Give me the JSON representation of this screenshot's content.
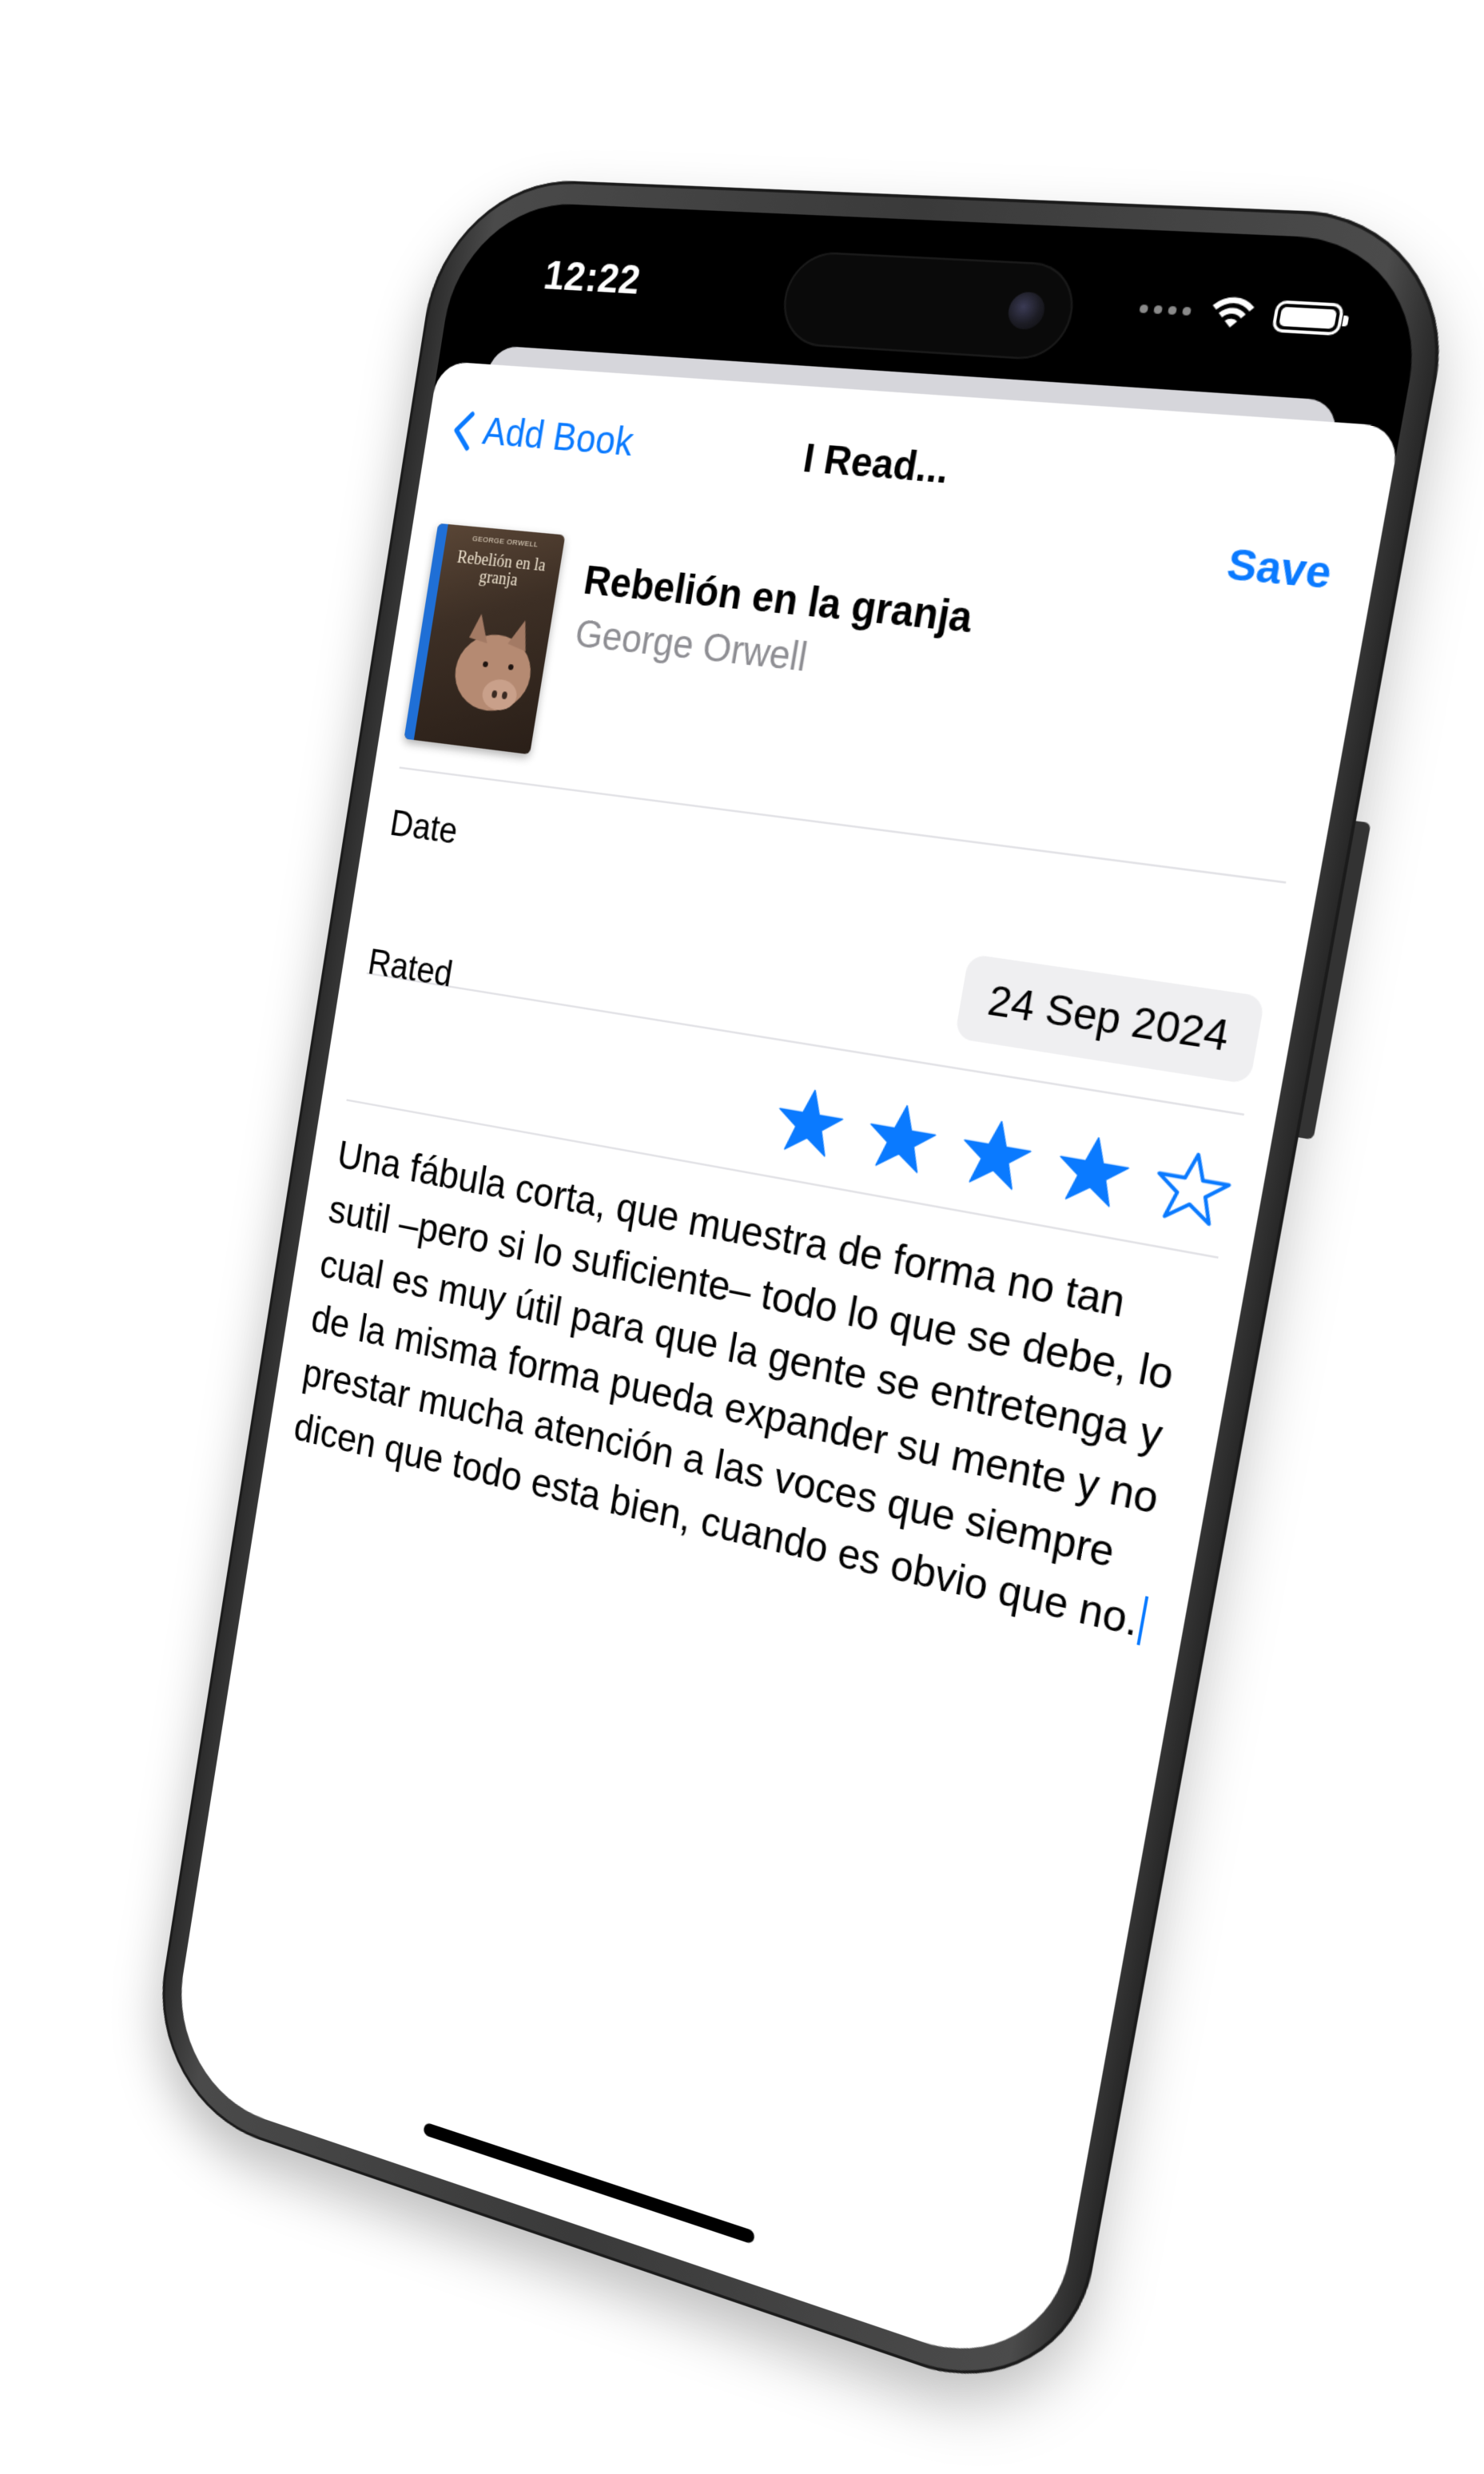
{
  "status_bar": {
    "time": "12:22",
    "icons": [
      "signal-icon",
      "wifi-icon",
      "battery-icon"
    ]
  },
  "nav": {
    "back_label": "Add Book",
    "back_icon": "chevron-left-icon",
    "title": "I Read...",
    "save_label": "Save"
  },
  "book": {
    "title": "Rebelión en la granja",
    "author": "George Orwell",
    "cover_author": "GEORGE ORWELL",
    "cover_title": "Rebelión en la granja"
  },
  "form": {
    "date_label": "Date",
    "date_value": "24 Sep 2024",
    "rated_label": "Rated",
    "rating": 4,
    "rating_max": 5
  },
  "review": {
    "text": "Una fábula corta, que muestra de forma no tan sutil –pero si lo suficiente– todo lo que se debe, lo cual es muy útil para que la gente se entretenga y de la misma forma pueda expander su mente y no prestar mucha atención a las voces que siempre dicen que todo esta bien, cuando es obvio que no."
  },
  "colors": {
    "accent": "#0a7aff",
    "secondary_text": "#8e8e93",
    "pill_background": "#efeff1"
  }
}
